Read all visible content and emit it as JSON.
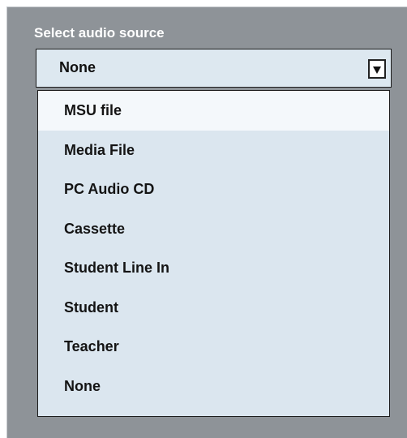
{
  "panel": {
    "label": "Select audio source"
  },
  "select": {
    "value": "None",
    "button_icon": "chevron-down-icon"
  },
  "options": [
    {
      "label": "MSU file",
      "highlighted": true
    },
    {
      "label": "Media File",
      "highlighted": false
    },
    {
      "label": "PC Audio CD",
      "highlighted": false
    },
    {
      "label": "Cassette",
      "highlighted": false
    },
    {
      "label": "Student Line In",
      "highlighted": false
    },
    {
      "label": "Student",
      "highlighted": false
    },
    {
      "label": "Teacher",
      "highlighted": false
    },
    {
      "label": "None",
      "highlighted": false
    }
  ],
  "colors": {
    "panel_bg": "#8e9398",
    "field_bg": "#dde8f0",
    "highlight_bg": "#f4f8fb",
    "text": "#141414",
    "label_text": "#ffffff"
  }
}
